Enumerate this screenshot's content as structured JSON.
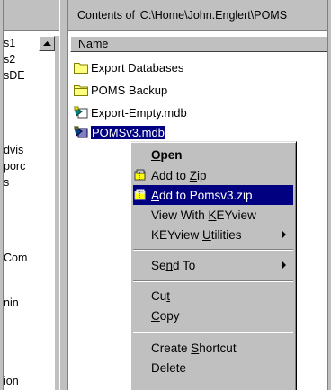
{
  "tree": {
    "items": [
      "s1",
      "s2",
      "sDE",
      "dvis",
      "porc",
      "s",
      "Com",
      "nin",
      "ion"
    ]
  },
  "contents": {
    "title": "Contents of 'C:\\Home\\John.Englert\\POMS",
    "column_name": "Name",
    "files": [
      {
        "name": "Export Databases",
        "icon": "folder-icon"
      },
      {
        "name": "POMS Backup",
        "icon": "folder-icon"
      },
      {
        "name": "Export-Empty.mdb",
        "icon": "access-db-icon"
      },
      {
        "name": "POMSv3.mdb",
        "icon": "access-db-icon"
      }
    ]
  },
  "menu": {
    "open": {
      "pre": "",
      "acc": "O",
      "post": "pen"
    },
    "add_zip": {
      "pre": "Add to ",
      "acc": "Z",
      "post": "ip"
    },
    "add_pomsv3": {
      "pre": "",
      "acc": "A",
      "post": "dd to Pomsv3.zip"
    },
    "view_keyview": {
      "pre": "View With ",
      "acc": "K",
      "post": "EYview"
    },
    "keyview_utilities": {
      "pre": "KEYview ",
      "acc": "U",
      "post": "tilities"
    },
    "send_to": {
      "pre": "Se",
      "acc": "n",
      "post": "d To"
    },
    "cut": {
      "pre": "Cu",
      "acc": "t",
      "post": ""
    },
    "copy": {
      "pre": "",
      "acc": "C",
      "post": "opy"
    },
    "create_shortcut": {
      "pre": "Create ",
      "acc": "S",
      "post": "hortcut"
    },
    "delete": {
      "pre": "Delete",
      "acc": "",
      "post": ""
    }
  },
  "colors": {
    "selection": "#000080",
    "face": "#c0c0c0",
    "folder": "#ffff80"
  }
}
